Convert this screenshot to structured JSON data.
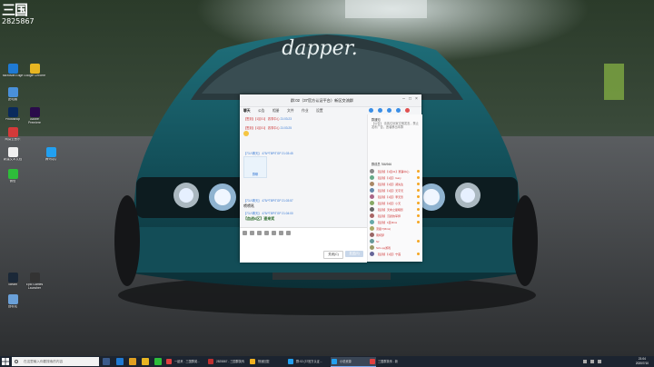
{
  "overlay": {
    "logo": "三国",
    "number": "2825867"
  },
  "desktop_icons": [
    {
      "label": "Microsoft Edge",
      "color": "#1f7ad3"
    },
    {
      "label": "Google Chrome",
      "color": "#e7b522"
    },
    {
      "label": "此电脑",
      "color": "#4a90d9"
    },
    {
      "label": "Photoshop",
      "color": "#0a2a5c"
    },
    {
      "label": "Adobe Premiere",
      "color": "#2a0b4a"
    },
    {
      "label": "网易云音乐",
      "color": "#d33a3a"
    },
    {
      "label": "新建文本文档",
      "color": "#f0f0f0"
    },
    {
      "label": "腾讯QQ",
      "color": "#22a0f0"
    },
    {
      "label": "微信",
      "color": "#2ebd3a"
    },
    {
      "label": "Steam",
      "color": "#1b2838"
    },
    {
      "label": "Epic Games Launcher",
      "color": "#333333"
    },
    {
      "label": "回收站",
      "color": "#6aa0d8"
    }
  ],
  "chat": {
    "title": "群:02（37官方认证平台）新区交流群",
    "tabs": [
      "聊天",
      "公告",
      "相册",
      "文件",
      "作业",
      "设置"
    ],
    "messages": [
      {
        "who": "【签到】【1区01】 赛事中心",
        "time": "21:03:23",
        "text": ""
      },
      {
        "who": "【签到】【1区01】 赛事中心",
        "time": "21:03:25",
        "text": ""
      },
      {
        "who": "【73人聊天】 475/*TBP/TGP",
        "time": "21:03:45",
        "text": ""
      },
      {
        "who": "【73人聊天】 475/*TBP/TGP",
        "time": "21:03:57",
        "text": "啧啧吼"
      },
      {
        "who": "【73人聊天】 475/*TBP/TGP",
        "time": "21:04:00",
        "text": "【血战6区】速来奖"
      }
    ],
    "image_caption": "群聊",
    "buttons": {
      "close": "关闭(C)",
      "send": "发送(S)"
    },
    "side": {
      "notice_title": "群通知",
      "notice_text": "【公告】 请各位玩家文明发言，禁止发布广告，违者移出本群",
      "members_title": "群成员 766/946",
      "members": [
        {
          "name": "【签到】【1区01】赛事中心",
          "color": "#c33"
        },
        {
          "name": "【签到】【1区】Gary",
          "color": "#c33"
        },
        {
          "name": "【签到】【1区】郑先生",
          "color": "#c33"
        },
        {
          "name": "【签到】【1区】无字天",
          "color": "#c33"
        },
        {
          "name": "【签到】【1区】李无影",
          "color": "#c33"
        },
        {
          "name": "【签到】【2区】小天",
          "color": "#c33"
        },
        {
          "name": "【签到】天命之星暗影",
          "color": "#c33"
        },
        {
          "name": "【签到】沉默的军师",
          "color": "#c33"
        },
        {
          "name": "【签到】1区Mimi",
          "color": "#c33"
        },
        {
          "name": "流星7(Mimi)",
          "color": "#c33"
        },
        {
          "name": "南柯梦",
          "color": "#c33"
        },
        {
          "name": "Sz",
          "color": "#c33"
        },
        {
          "name": "Sztv qq游戏",
          "color": "#c33"
        },
        {
          "name": "【签到】【1区】宁莲",
          "color": "#c33"
        }
      ]
    }
  },
  "taskbar": {
    "search_placeholder": "在这里输入你要搜索的内容",
    "windows": [
      {
        "label": "一起来 - 三国群英...",
        "color": "#e04040"
      },
      {
        "label": "2825867 - 三国群英传",
        "color": "#c03030"
      },
      {
        "label": "快速回复",
        "color": "#f0b020"
      },
      {
        "label": "群:02 (37官方认证...",
        "color": "#22a0f0"
      },
      {
        "label": "小说资源",
        "color": "#22a0f0"
      },
      {
        "label": "三国群英传 - 新",
        "color": "#e04040"
      }
    ],
    "time": "21:04",
    "date": "2020/7/10"
  }
}
